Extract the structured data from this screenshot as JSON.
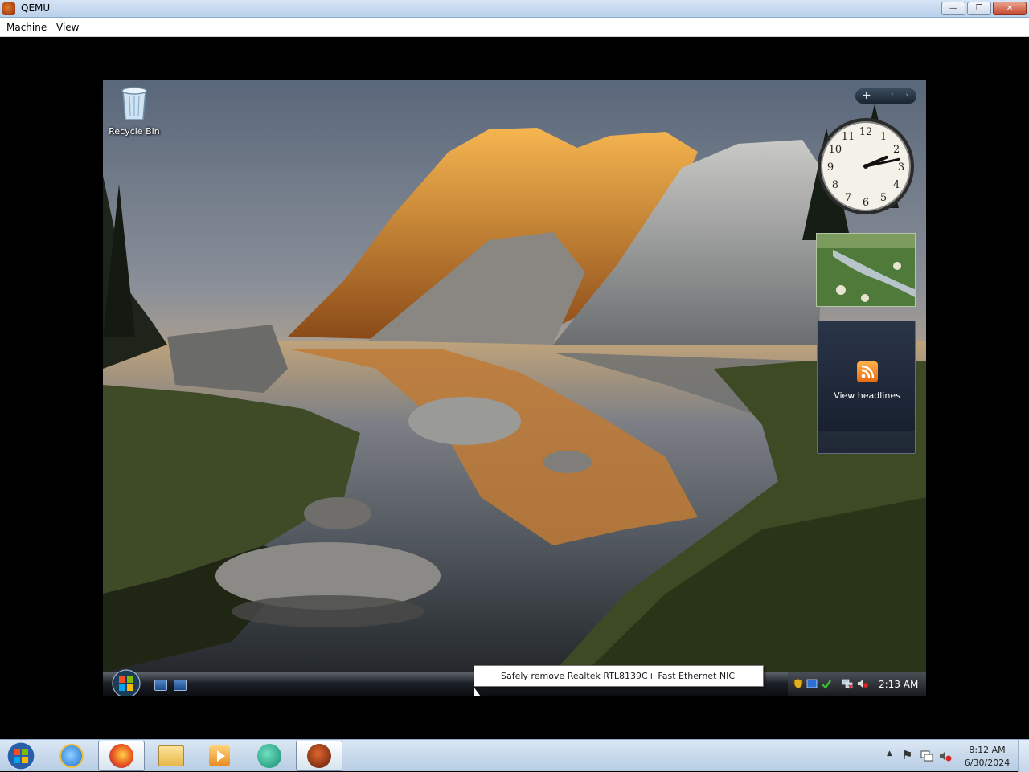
{
  "window": {
    "title": "QEMU",
    "buttons": {
      "minimize": "—",
      "restore": "❐",
      "close": "✕"
    }
  },
  "menu": {
    "items": [
      "Machine",
      "View"
    ]
  },
  "guest": {
    "desktop_icons": [
      {
        "label": "Recycle Bin",
        "icon": "recycle-bin-icon"
      }
    ],
    "gadgets": {
      "controls": {
        "add": "+",
        "prev": "‹",
        "next": "›"
      },
      "clock": {
        "numbers": [
          "12",
          "1",
          "2",
          "3",
          "4",
          "5",
          "6",
          "7",
          "8",
          "9",
          "10",
          "11"
        ],
        "time": "2:13"
      },
      "feed": {
        "label": "View headlines"
      }
    },
    "taskbar": {
      "clock": "2:13 AM",
      "tooltip": "Safely remove Realtek RTL8139C+ Fast Ethernet NIC"
    }
  },
  "host_taskbar": {
    "pinned": [
      {
        "name": "internet-explorer-icon"
      },
      {
        "name": "firefox-icon"
      },
      {
        "name": "file-explorer-icon"
      },
      {
        "name": "media-player-icon"
      },
      {
        "name": "browser-app-icon"
      },
      {
        "name": "qemu-icon"
      }
    ],
    "tray_symbols": {
      "expand": "▲",
      "flag": "⚑"
    },
    "clock": {
      "time": "8:12 AM",
      "date": "6/30/2024"
    }
  },
  "colors": {
    "titlebar": "#b9d1ea",
    "guest_taskbar": "#1d2127",
    "host_taskbar": "#c7d9ec"
  }
}
